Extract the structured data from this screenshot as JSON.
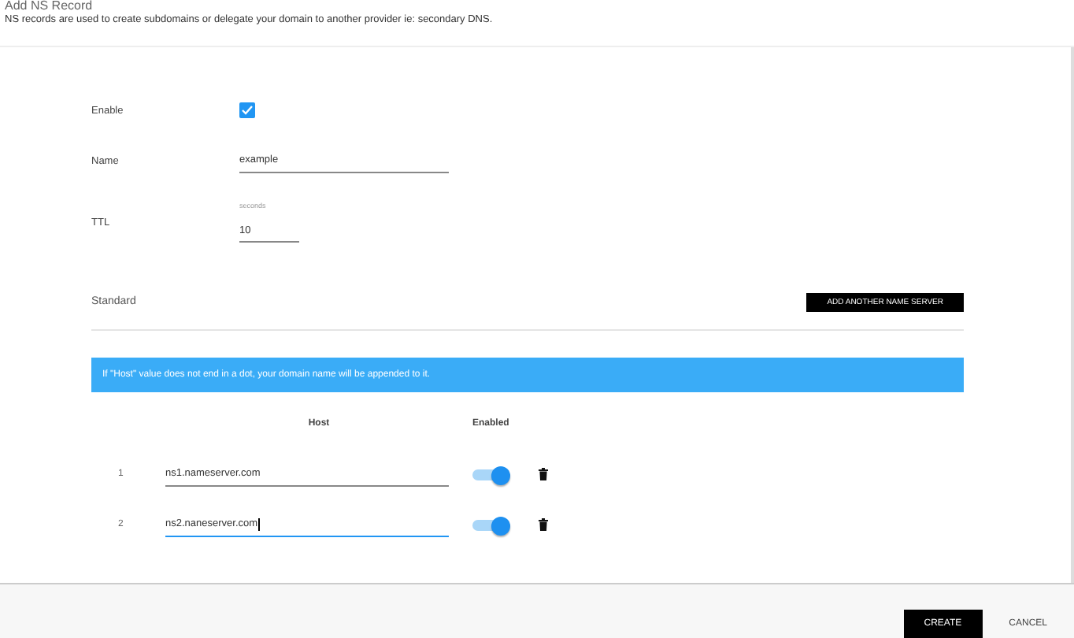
{
  "header": {
    "title": "Add NS Record",
    "description": "NS records are used to create subdomains or delegate your domain to another provider ie: secondary DNS."
  },
  "form": {
    "enable": {
      "label": "Enable",
      "checked": true
    },
    "name": {
      "label": "Name",
      "value": "example"
    },
    "ttl": {
      "label": "TTL",
      "hint": "seconds",
      "value": "10"
    }
  },
  "section": {
    "title": "Standard",
    "add_button": "ADD ANOTHER NAME SERVER"
  },
  "info": "If \"Host\" value does not end in a dot, your domain name will be appended to it.",
  "table": {
    "columns": [
      "Host",
      "Enabled"
    ],
    "rows": [
      {
        "index": "1",
        "host": "ns1.nameserver.com",
        "enabled": true,
        "focused": false
      },
      {
        "index": "2",
        "host": "ns2.naneserver.com",
        "enabled": true,
        "focused": true
      }
    ]
  },
  "footer": {
    "buttons": [
      {
        "label": "CREATE",
        "kind": "primary"
      },
      {
        "label": "CANCEL",
        "kind": "text"
      }
    ]
  }
}
